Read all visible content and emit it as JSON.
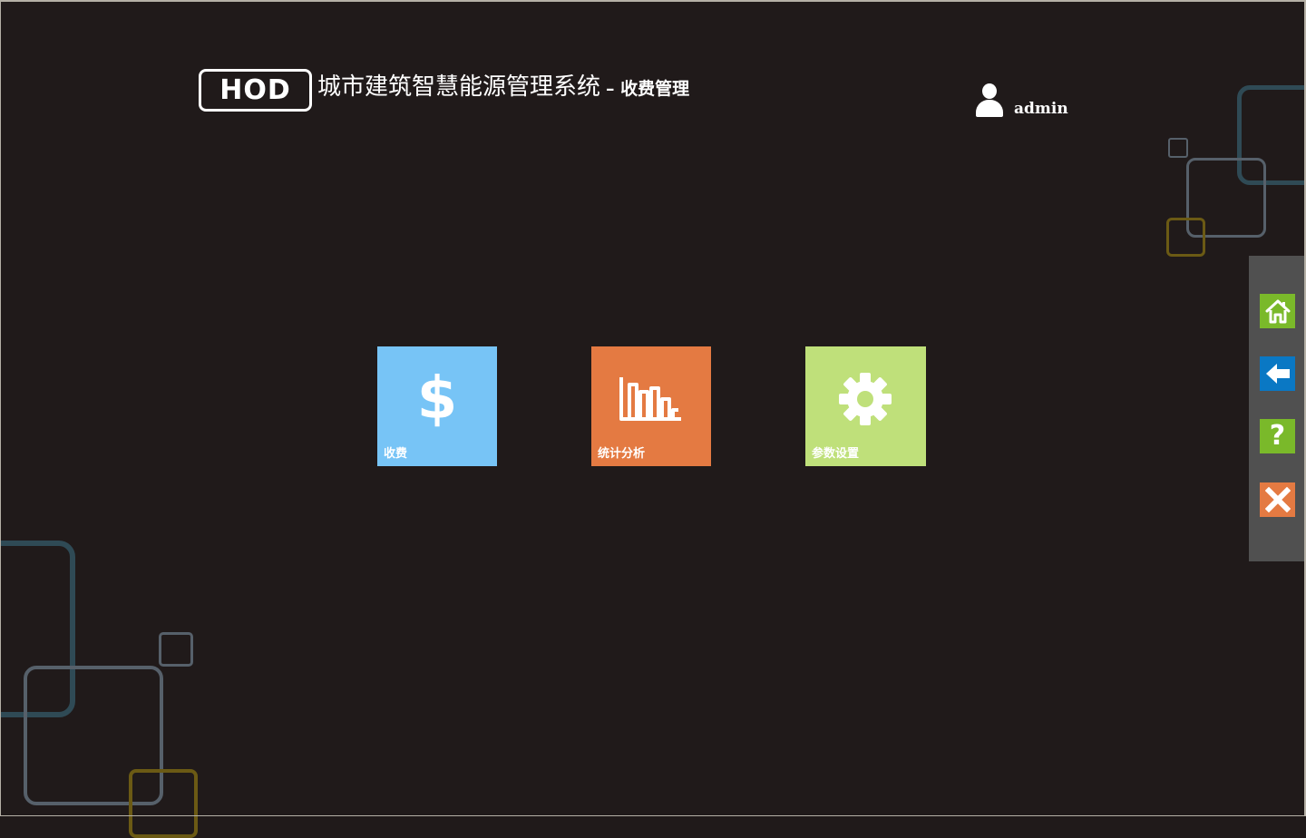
{
  "header": {
    "logo_text": "HOD",
    "title": "城市建筑智慧能源管理系统",
    "subtitle": "– 收费管理",
    "user": {
      "icon": "user-icon",
      "name": "admin"
    }
  },
  "tiles": [
    {
      "label": "收费",
      "icon": "dollar-icon",
      "color": "#77c4f6"
    },
    {
      "label": "统计分析",
      "icon": "bar-chart-icon",
      "color": "#e47a42"
    },
    {
      "label": "参数设置",
      "icon": "gear-icon",
      "color": "#bfe07a"
    }
  ],
  "side_toolbar": {
    "items": [
      {
        "icon": "home-icon",
        "color": "#7ab92a"
      },
      {
        "icon": "back-arrow-icon",
        "color": "#0a78c4"
      },
      {
        "icon": "help-icon",
        "color": "#7ab92a",
        "glyph": "?"
      },
      {
        "icon": "close-icon",
        "color": "#e47a42"
      }
    ]
  },
  "colors": {
    "background": "#201a1a",
    "side_panel": "#505050"
  }
}
